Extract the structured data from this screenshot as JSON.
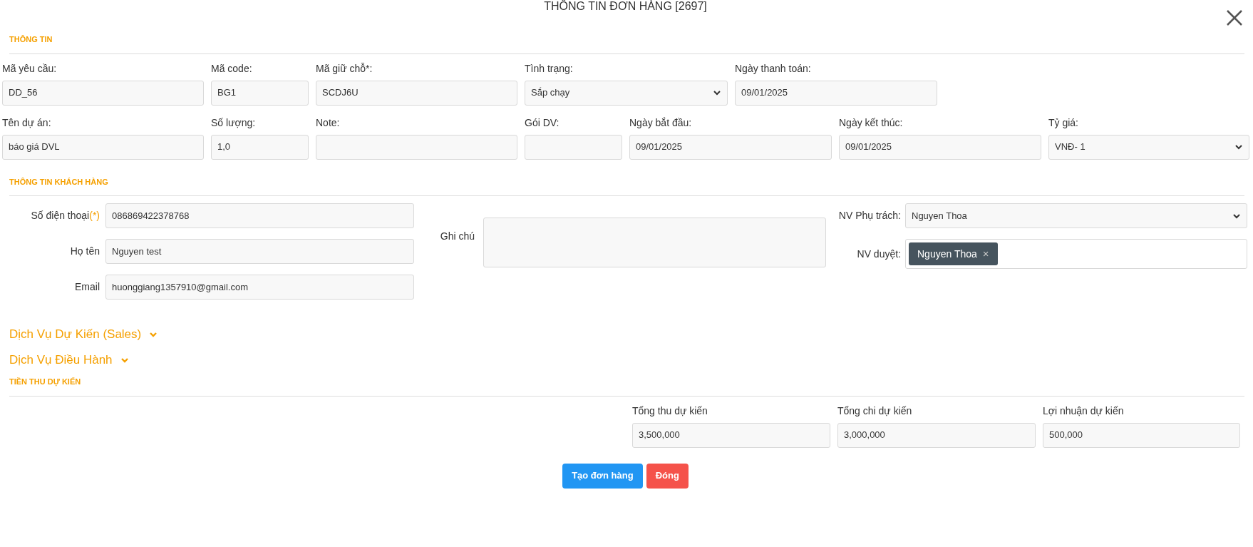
{
  "title": "THÔNG TIN ĐƠN HÀNG [2697]",
  "order_info": {
    "heading": "THÔNG TIN",
    "rows": [
      [
        {
          "label": "Mã yêu cầu:",
          "kind": "input",
          "value": "DD_56"
        },
        {
          "label": "Mã code:",
          "kind": "input",
          "value": "BG1"
        },
        {
          "label": "Mã giữ chỗ*:",
          "kind": "input",
          "value": "SCDJ6U"
        },
        {
          "label": "Tình trạng:",
          "kind": "select",
          "value": "Sắp chạy"
        },
        {
          "label": "Ngày thanh toán:",
          "kind": "input",
          "value": "09/01/2025"
        }
      ],
      [
        {
          "label": "Tên dự án:",
          "kind": "input",
          "value": "báo giá DVL"
        },
        {
          "label": "Số lượng:",
          "kind": "input",
          "value": "1,0"
        },
        {
          "label": "Note:",
          "kind": "input"
        },
        {
          "label": "Gói DV:",
          "kind": "input"
        },
        {
          "label": "Ngày bắt đầu:",
          "kind": "input",
          "value": "09/01/2025"
        },
        {
          "label": "Ngày kết thúc:",
          "kind": "input",
          "value": "09/01/2025"
        },
        {
          "label": "Tỷ giá:",
          "kind": "select",
          "value": "VNĐ- 1"
        }
      ]
    ]
  },
  "customer": {
    "heading": "THÔNG TIN KHÁCH HÀNG",
    "fields": [
      {
        "label": "Số điện thoại",
        "required_mark": "(*)",
        "value": "086869422378768"
      },
      {
        "label": "Họ tên",
        "value": "Nguyen test"
      },
      {
        "label": "Email",
        "value": "huonggiang1357910@gmail.com"
      }
    ],
    "note": {
      "label": "Ghi chú"
    },
    "staff": {
      "label": "NV Phụ trách:",
      "value": "Nguyen Thoa"
    },
    "approver": {
      "label": "NV duyệt:",
      "tags": [
        {
          "text": "Nguyen Thoa",
          "remove": "×"
        }
      ]
    }
  },
  "collapsibles": [
    {
      "title": "Dịch Vụ Dự Kiến (Sales)",
      "expanded": false
    },
    {
      "title": "Dịch Vụ Điều Hành",
      "expanded": false
    }
  ],
  "revenue": {
    "heading": "TIỀN THU DỰ KIẾN",
    "fields": [
      {
        "label": "Tổng thu dự kiến",
        "value": "3,500,000"
      },
      {
        "label": "Tổng chi dự kiến",
        "value": "3,000,000"
      },
      {
        "label": "Lợi nhuận dự kiến",
        "value": "500,000"
      }
    ]
  },
  "buttons": [
    {
      "label": "Tạo đơn hàng",
      "kind": "primary"
    },
    {
      "label": "Đóng",
      "kind": "danger"
    }
  ]
}
